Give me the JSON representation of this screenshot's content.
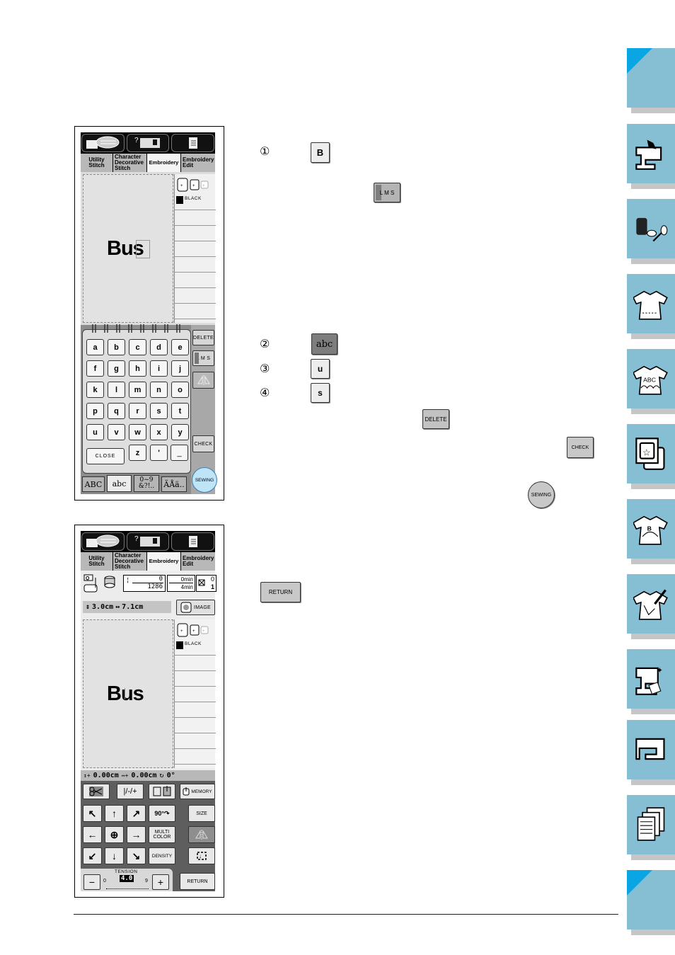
{
  "screen1": {
    "tabs": [
      "Utility\nStitch",
      "Character\nDecorative\nStitch",
      "Embroidery",
      "Embroidery\nEdit"
    ],
    "active_tab": "Embroidery",
    "preview_text": "Bus",
    "thread_color": "BLACK",
    "keyboard_keys": [
      "a",
      "b",
      "c",
      "d",
      "e",
      "f",
      "g",
      "h",
      "i",
      "j",
      "k",
      "l",
      "m",
      "n",
      "o",
      "p",
      "q",
      "r",
      "s",
      "t",
      "u",
      "v",
      "w",
      "x",
      "y"
    ],
    "close_label": "CLOSE",
    "extra_keys": [
      "z",
      "'",
      "_"
    ],
    "side_buttons": {
      "delete": "DELETE",
      "size": "L M S",
      "check": "CHECK",
      "sewing": "SEWING"
    },
    "bottom_tabs": [
      "ABC",
      "abc",
      "0~9\n&?!..",
      "ÄÅä.."
    ],
    "active_bottom_tab": "abc"
  },
  "screen2": {
    "tabs": [
      "Utility\nStitch",
      "Character\nDecorative\nStitch",
      "Embroidery",
      "Embroidery\nEdit"
    ],
    "stitch_count_top": "0",
    "stitch_count_total": "1286",
    "time_top": "0min",
    "time_total": "4min",
    "color_count_top": "0",
    "color_count_total": "1",
    "height": "3.0cm",
    "width": "7.1cm",
    "image_label": "IMAGE",
    "preview_text": "Bus",
    "thread_color": "BLACK",
    "position_y": "0.00cm",
    "position_x": "0.00cm",
    "rotation": "0°",
    "buttons": {
      "memory": "MEMORY",
      "rotate": "90°",
      "size": "SIZE",
      "multi_color": "MULTI\nCOLOR",
      "density": "DENSITY",
      "return": "RETURN"
    },
    "tension_label": "TENSION",
    "tension_value": "4.0",
    "tension_min": "0",
    "tension_max": "9"
  },
  "steps": {
    "step1": {
      "num": "①",
      "key": "B"
    },
    "lms_label": "L M S",
    "step2": {
      "num": "②",
      "key": "abc"
    },
    "step3": {
      "num": "③",
      "key": "u"
    },
    "step4": {
      "num": "④",
      "key": "s"
    },
    "delete_label": "DELETE",
    "check_label": "CHECK",
    "sewing_label": "SEWING",
    "return_label": "RETURN"
  },
  "side_tabs": [
    "blank-top",
    "sewing-machine",
    "thread-spools",
    "shirt-utility",
    "shirt-abc",
    "embroidery-hoop",
    "shirt-monogram",
    "shirt-edit",
    "machine-maintenance",
    "machine",
    "documents",
    "blank-bottom"
  ],
  "colors": {
    "side_tab": "#86bfd3",
    "tab_corner": "#0aa6e3",
    "sewing_button": "#bfe3f7"
  }
}
